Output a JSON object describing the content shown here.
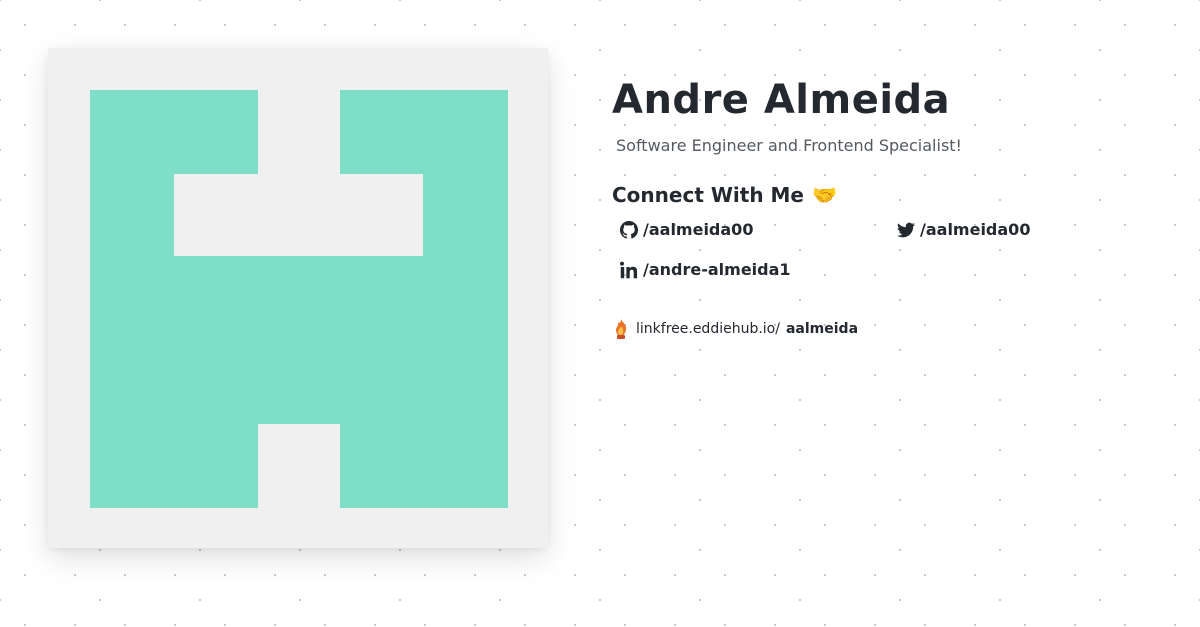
{
  "profile": {
    "name": "Andre Almeida",
    "bio": "Software Engineer and Frontend Specialist!"
  },
  "connect": {
    "heading": "Connect With Me",
    "emoji": "🤝",
    "links": [
      {
        "icon": "github-icon",
        "label": "/aalmeida00"
      },
      {
        "icon": "twitter-icon",
        "label": "/aalmeida00"
      },
      {
        "icon": "linkedin-icon",
        "label": "/andre-almeida1"
      }
    ]
  },
  "linkfree": {
    "icon": "linkfree-flame-icon",
    "domain": "linkfree.eddiehub.io/",
    "username": "aalmeida"
  },
  "colors": {
    "avatar_fg": "#7ddfc7",
    "avatar_bg": "#f0f0f0",
    "text": "#24292f",
    "muted": "#555a60"
  }
}
